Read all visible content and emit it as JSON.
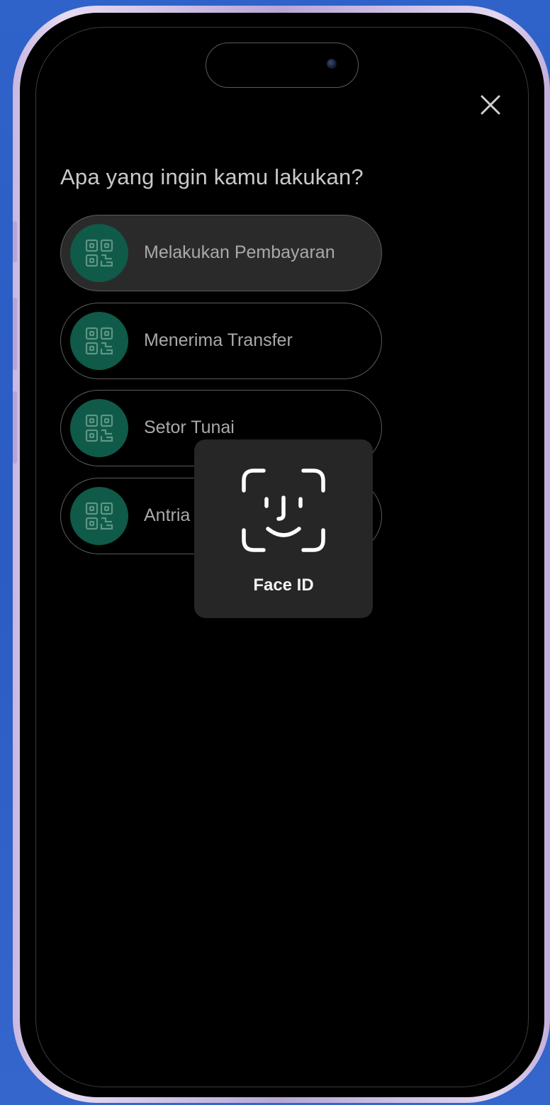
{
  "heading": "Apa yang ingin kamu lakukan?",
  "close": {
    "icon": "close-icon"
  },
  "options": [
    {
      "label": "Melakukan Pembayaran",
      "icon": "qr-code-icon",
      "selected": true
    },
    {
      "label": "Menerima Transfer",
      "icon": "qr-code-icon",
      "selected": false
    },
    {
      "label": "Setor Tunai",
      "icon": "qr-code-icon",
      "selected": false
    },
    {
      "label": "Antria",
      "icon": "qr-code-icon",
      "selected": false
    }
  ],
  "face_id": {
    "label": "Face ID",
    "icon": "face-id-icon"
  },
  "colors": {
    "background": "#2f63c9",
    "screen": "#000000",
    "icon_circle": "#0f5a48",
    "selected_option": "#2a2a2a",
    "overlay": "#262626"
  }
}
